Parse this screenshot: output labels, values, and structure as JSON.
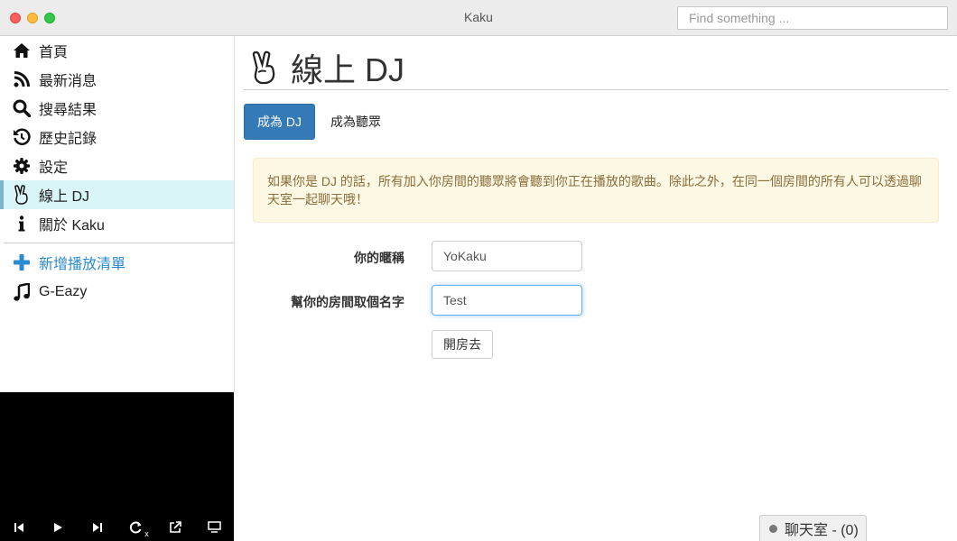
{
  "window": {
    "title": "Kaku",
    "search_placeholder": "Find something ..."
  },
  "sidebar": {
    "items": [
      {
        "label": "首頁",
        "icon": "home-icon"
      },
      {
        "label": "最新消息",
        "icon": "rss-icon"
      },
      {
        "label": "搜尋結果",
        "icon": "search-icon"
      },
      {
        "label": "歷史記錄",
        "icon": "history-icon"
      },
      {
        "label": "設定",
        "icon": "gear-icon"
      },
      {
        "label": "線上 DJ",
        "icon": "hand-peace-icon",
        "active": true
      },
      {
        "label": "關於 Kaku",
        "icon": "info-icon"
      }
    ],
    "add_playlist": {
      "label": "新增播放清單",
      "icon": "plus-icon",
      "color": "#2a8ad2"
    },
    "playlists": [
      {
        "label": "G-Eazy",
        "icon": "music-icon"
      }
    ]
  },
  "player": {
    "controls": [
      {
        "name": "previous",
        "icon": "step-backward-icon"
      },
      {
        "name": "play",
        "icon": "play-icon"
      },
      {
        "name": "next",
        "icon": "step-forward-icon"
      },
      {
        "name": "repeat",
        "icon": "repeat-icon",
        "badge": "x"
      },
      {
        "name": "external",
        "icon": "external-link-icon"
      },
      {
        "name": "tv",
        "icon": "tv-icon"
      }
    ]
  },
  "main": {
    "title": "線上 DJ",
    "tabs": [
      {
        "label": "成為 DJ",
        "active": true
      },
      {
        "label": "成為聽眾",
        "active": false
      }
    ],
    "alert": "如果你是 DJ 的話，所有加入你房間的聽眾將會聽到你正在播放的歌曲。除此之外，在同一個房間的所有人可以透過聊天室一起聊天哦！",
    "form": {
      "nickname_label": "你的暱稱",
      "nickname_value": "YoKaku",
      "room_label": "幫你的房間取個名字",
      "room_value": "Test",
      "submit_label": "開房去"
    }
  },
  "chat": {
    "label": "聊天室 - (0)"
  },
  "colors": {
    "accent": "#337ab7",
    "active_nav": "#d9f5f8",
    "alert_bg": "#fcf8e3",
    "alert_text": "#8a6d3b"
  }
}
